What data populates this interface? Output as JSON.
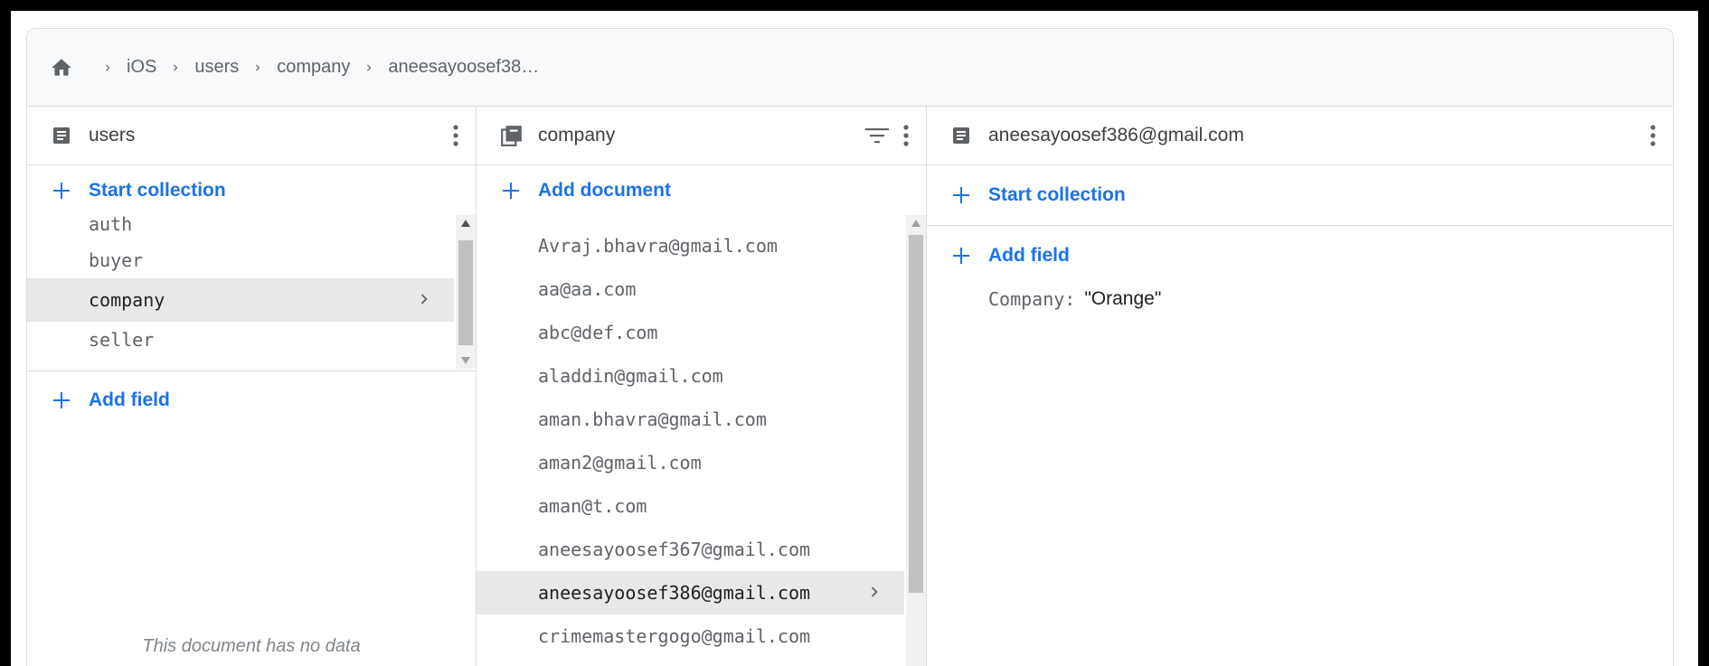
{
  "breadcrumb": {
    "items": [
      "iOS",
      "users",
      "company",
      "aneesayoosef38…"
    ]
  },
  "columns": {
    "users": {
      "title": "users",
      "start_collection_label": "Start collection",
      "collections": [
        "auth",
        "buyer",
        "company",
        "seller"
      ],
      "selected_index": 2,
      "add_field_label": "Add field",
      "empty_note": "This document has no data"
    },
    "company": {
      "title": "company",
      "add_document_label": "Add document",
      "documents": [
        "Avraj.bhavra@gmail.com",
        "aa@aa.com",
        "abc@def.com",
        "aladdin@gmail.com",
        "aman.bhavra@gmail.com",
        "aman2@gmail.com",
        "aman@t.com",
        "aneesayoosef367@gmail.com",
        "aneesayoosef386@gmail.com",
        "crimemastergogo@gmail.com"
      ],
      "selected_index": 8
    },
    "document": {
      "title": "aneesayoosef386@gmail.com",
      "start_collection_label": "Start collection",
      "add_field_label": "Add field",
      "fields": [
        {
          "key": "Company:",
          "value": "\"Orange\""
        }
      ]
    }
  },
  "colors": {
    "accent": "#1a73e8",
    "selected_row": "#e8e8e8",
    "border": "#dadce0"
  },
  "icons": {
    "home": "home-icon",
    "chevron": "chevron-right-icon",
    "document": "document-icon",
    "collection": "collection-icon",
    "kebab": "more-vert-icon",
    "filter": "filter-icon",
    "plus": "plus-icon"
  }
}
